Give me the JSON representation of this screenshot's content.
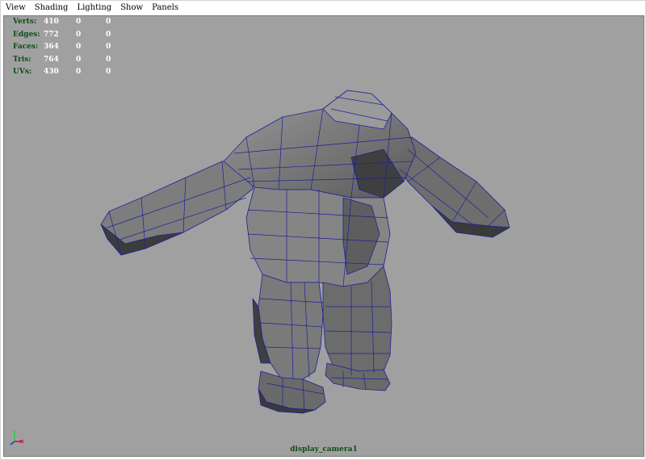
{
  "menu": {
    "items": [
      "View",
      "Shading",
      "Lighting",
      "Show",
      "Panels"
    ]
  },
  "hud": {
    "rows": [
      {
        "label": "Verts:",
        "values": [
          "410",
          "0",
          "0"
        ]
      },
      {
        "label": "Edges:",
        "values": [
          "772",
          "0",
          "0"
        ]
      },
      {
        "label": "Faces:",
        "values": [
          "364",
          "0",
          "0"
        ]
      },
      {
        "label": "Tris:",
        "values": [
          "764",
          "0",
          "0"
        ]
      },
      {
        "label": "UVs:",
        "values": [
          "430",
          "0",
          "0"
        ]
      }
    ]
  },
  "camera_label": "display_camera1",
  "colors": {
    "viewport_bg": "#a0a0a0",
    "hud_label": "#0e4f13",
    "hud_value": "#ffffff",
    "wireframe": "#1f1f9a",
    "mesh_light": "#8a8a8a",
    "mesh_dark": "#3a3a3a",
    "axis_x": "#c8102e",
    "axis_y": "#2ecc40"
  },
  "icons": {
    "axis_gizmo": "xyz-axis-icon"
  }
}
